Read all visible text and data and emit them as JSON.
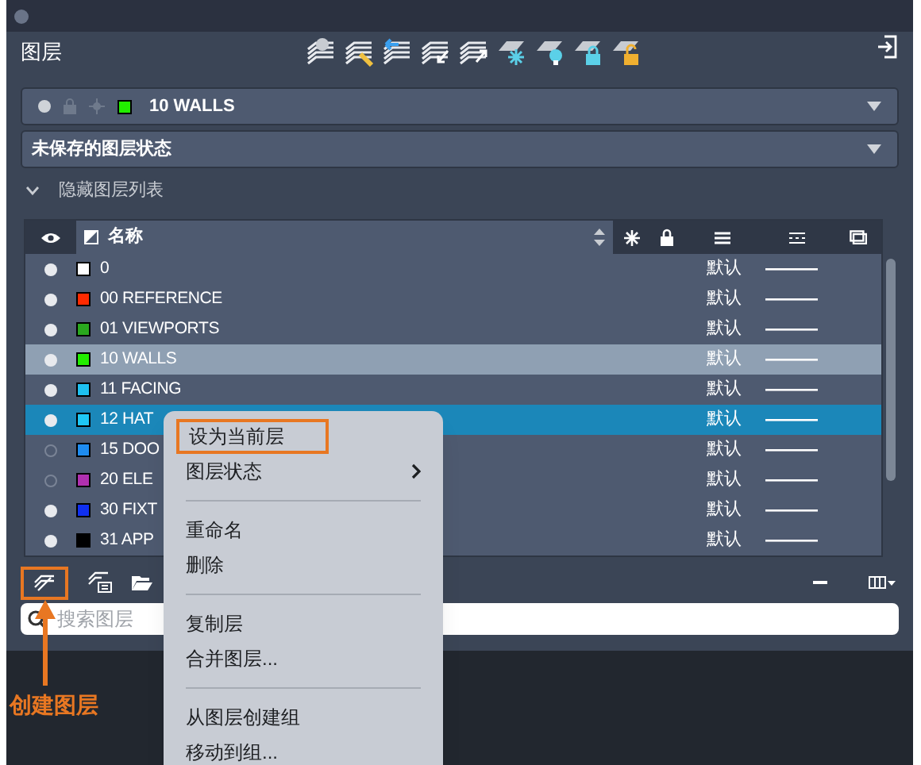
{
  "panel": {
    "title": "图层"
  },
  "current_layer": {
    "name": "10 WALLS",
    "color": "#22ee00"
  },
  "layer_state": {
    "value": "未保存的图层状态"
  },
  "hide_list": {
    "label": "隐藏图层列表",
    "expanded": true
  },
  "table": {
    "columns": [
      {
        "label": "名称"
      }
    ],
    "rows": [
      {
        "name": "0",
        "color": "#ffffff",
        "on": true,
        "linetype": "默认",
        "current": false,
        "selected": false
      },
      {
        "name": "00 REFERENCE",
        "color": "#ff2a00",
        "on": true,
        "linetype": "默认",
        "current": false,
        "selected": false
      },
      {
        "name": "01 VIEWPORTS",
        "color": "#2aa81e",
        "on": true,
        "linetype": "默认",
        "current": false,
        "selected": false
      },
      {
        "name": "10 WALLS",
        "color": "#22ee00",
        "on": true,
        "linetype": "默认",
        "current": true,
        "selected": false
      },
      {
        "name": "11 FACING",
        "color": "#1ec0f0",
        "on": true,
        "linetype": "默认",
        "current": false,
        "selected": false
      },
      {
        "name": "12 HAT",
        "color": "#1ec8f5",
        "on": true,
        "linetype": "默认",
        "current": false,
        "selected": true
      },
      {
        "name": "15 DOO",
        "color": "#1e8cf0",
        "on": false,
        "linetype": "默认",
        "current": false,
        "selected": false
      },
      {
        "name": "20 ELE",
        "color": "#b030b0",
        "on": false,
        "linetype": "默认",
        "current": false,
        "selected": false
      },
      {
        "name": "30 FIXT",
        "color": "#1030f0",
        "on": true,
        "linetype": "默认",
        "current": false,
        "selected": false
      },
      {
        "name": "31 APP",
        "color": "#000000",
        "on": true,
        "linetype": "默认",
        "current": false,
        "selected": false
      }
    ]
  },
  "search": {
    "placeholder": "搜索图层"
  },
  "context_menu": {
    "items": [
      {
        "kind": "item",
        "label": "设为当前层",
        "highlighted": true,
        "submenu": false
      },
      {
        "kind": "item",
        "label": "图层状态",
        "highlighted": false,
        "submenu": true
      },
      {
        "kind": "separator"
      },
      {
        "kind": "item",
        "label": "重命名",
        "highlighted": false,
        "submenu": false
      },
      {
        "kind": "item",
        "label": "删除",
        "highlighted": false,
        "submenu": false
      },
      {
        "kind": "separator"
      },
      {
        "kind": "item",
        "label": "复制层",
        "highlighted": false,
        "submenu": false
      },
      {
        "kind": "item",
        "label": "合并图层...",
        "highlighted": false,
        "submenu": false
      },
      {
        "kind": "separator"
      },
      {
        "kind": "item",
        "label": "从图层创建组",
        "highlighted": false,
        "submenu": false
      },
      {
        "kind": "item",
        "label": "移动到组...",
        "highlighted": false,
        "submenu": false
      }
    ]
  },
  "annotation": {
    "label": "创建图层"
  }
}
